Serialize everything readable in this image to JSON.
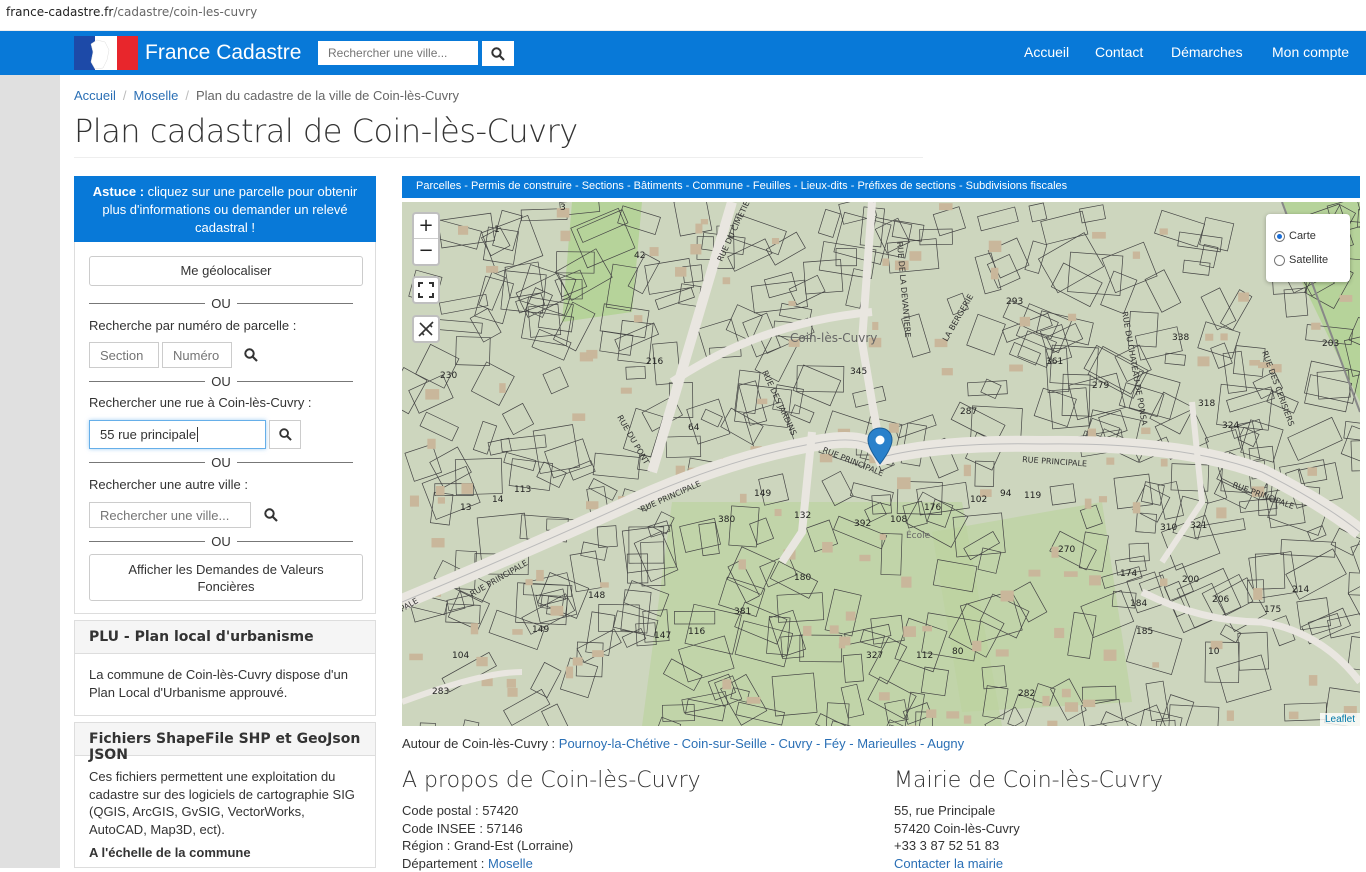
{
  "browser": {
    "url_domain": "france-cadastre.fr",
    "url_path": "/cadastre/coin-les-cuvry"
  },
  "navbar": {
    "brand": "France Cadastre",
    "search_placeholder": "Rechercher une ville...",
    "links": [
      "Accueil",
      "Contact",
      "Démarches",
      "Mon compte"
    ],
    "colors": {
      "bar": "#0879d8",
      "flag_blue": "#1d4aa8",
      "flag_white": "#ffffff",
      "flag_red": "#e8262c"
    }
  },
  "breadcrumb": [
    "Accueil",
    "Moselle",
    "Plan du cadastre de la ville de Coin-lès-Cuvry"
  ],
  "title": "Plan cadastral de Coin-lès-Cuvry",
  "tip": {
    "bold": "Astuce :",
    "text": " cliquez sur une parcelle pour obtenir plus d'informations ou demander un relevé cadastral !"
  },
  "sidebar": {
    "geoloc": "Me géolocaliser",
    "ou": "OU",
    "parcel_label": "Recherche par numéro de parcelle :",
    "section_placeholder": "Section",
    "numero_placeholder": "Numéro",
    "street_label": "Rechercher une rue à Coin-lès-Cuvry :",
    "street_value": "55 rue principale",
    "city_label": "Rechercher une autre ville :",
    "city_placeholder": "Rechercher une ville...",
    "dvf_button": "Afficher les Demandes de Valeurs Foncières"
  },
  "plu": {
    "title": "PLU - Plan local d'urbanisme",
    "text": "La commune de Coin-lès-Cuvry dispose d'un Plan Local d'Urbanisme approuvé."
  },
  "shapefile": {
    "title": "Fichiers ShapeFile SHP et GeoJson JSON",
    "text": "Ces fichiers permettent une exploitation du cadastre sur des logiciels de cartographie SIG (QGIS, ArcGIS, GvSIG, VectorWorks, AutoCAD, Map3D, ect).",
    "subtitle": "A l'échelle de la commune"
  },
  "map": {
    "tabs": [
      "Parcelles",
      "Permis de construire",
      "Sections",
      "Bâtiments",
      "Commune",
      "Feuilles",
      "Lieux-dits",
      "Préfixes de sections",
      "Subdivisions fiscales"
    ],
    "tab_separator": " - ",
    "zoom_in": "+",
    "zoom_out": "−",
    "layers": [
      {
        "label": "Carte",
        "selected": true
      },
      {
        "label": "Satellite",
        "selected": false
      }
    ],
    "attribution": "Leaflet",
    "street_labels": [
      "RUE PRINCIPALE",
      "RUE PRINCIPALE",
      "RUE PRINCIPALE",
      "RUE PRINCIPALE",
      "RUE PRINCIPALE",
      "LA BERGERIE",
      "RUE DU CHATEAU DE PONSA",
      "RUE DES CERISIERS",
      "RUE DU PONT",
      "RUE DES JARDINS",
      "RUE DU CIMETIERE",
      "RUE DE LA DEVANTIERE",
      "PALE"
    ],
    "place_labels": [
      "Coin-lès-Cuvry",
      "École"
    ],
    "parcel_numbers": [
      "1",
      "3",
      "230",
      "42",
      "216",
      "345",
      "287",
      "293",
      "361",
      "279",
      "338",
      "324",
      "318",
      "203",
      "64",
      "380",
      "392",
      "108",
      "176",
      "148",
      "381",
      "149",
      "147",
      "116",
      "180",
      "327",
      "112",
      "80",
      "282",
      "270",
      "174",
      "10",
      "13",
      "14",
      "113",
      "283",
      "104",
      "102",
      "94",
      "119",
      "132",
      "149",
      "184",
      "185",
      "175",
      "206",
      "214",
      "200",
      "310",
      "321"
    ]
  },
  "around": {
    "label": "Autour de Coin-lès-Cuvry : ",
    "towns": [
      "Pournoy-la-Chétive",
      "Coin-sur-Seille",
      "Cuvry",
      "Féy",
      "Marieulles",
      "Augny"
    ],
    "separator": " - "
  },
  "about": {
    "title": "A propos de Coin-lès-Cuvry",
    "lines": [
      {
        "label": "Code postal : ",
        "value": "57420"
      },
      {
        "label": "Code INSEE : ",
        "value": "57146"
      },
      {
        "label": "Région : ",
        "value": "Grand-Est (Lorraine)"
      },
      {
        "label": "Département : ",
        "value": "Moselle"
      }
    ]
  },
  "mairie": {
    "title": "Mairie de Coin-lès-Cuvry",
    "address": "55, rue Principale",
    "city": "57420 Coin-lès-Cuvry",
    "phone": "+33 3 87 52 51 83",
    "contact_link": "Contacter la mairie"
  }
}
